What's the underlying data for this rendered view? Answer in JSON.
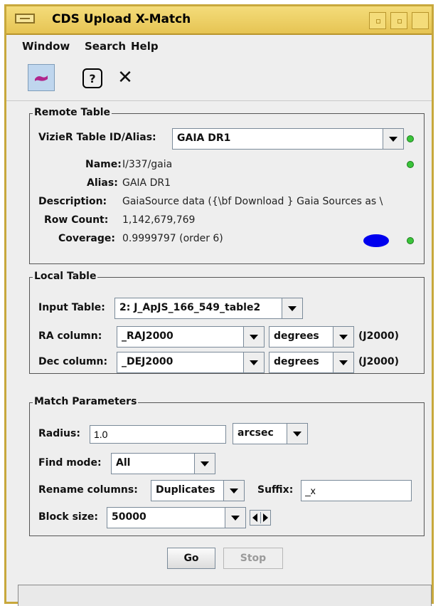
{
  "window": {
    "title": "CDS Upload X-Match"
  },
  "menubar": {
    "items": [
      "Window",
      "Search",
      "Help"
    ]
  },
  "toolbar": {
    "icons": [
      "query-active-icon",
      "help-icon",
      "close-icon"
    ],
    "help_glyph": "?",
    "close_glyph": "✕"
  },
  "remote": {
    "legend": "Remote Table",
    "vizier_label": "VizieR Table ID/Alias:",
    "vizier_value": "GAIA DR1",
    "name_label": "Name:",
    "name_value": "I/337/gaia",
    "alias_label": "Alias:",
    "alias_value": "GAIA DR1",
    "description_label": "Description:",
    "description_value": "GaiaSource data ({\\bf Download } Gaia Sources as \\",
    "rowcount_label": "Row Count:",
    "rowcount_value": "1,142,679,769",
    "coverage_label": "Coverage:",
    "coverage_value": "0.9999797 (order 6)",
    "status_color": "#3ac43a",
    "coverage_color": "#0000ee"
  },
  "local": {
    "legend": "Local Table",
    "input_label": "Input Table:",
    "input_value": "2: J_ApJS_166_549_table2",
    "ra_label": "RA column:",
    "ra_value": "_RAJ2000",
    "ra_unit": "degrees",
    "ra_epoch": "(J2000)",
    "dec_label": "Dec column:",
    "dec_value": "_DEJ2000",
    "dec_unit": "degrees",
    "dec_epoch": "(J2000)"
  },
  "match": {
    "legend": "Match Parameters",
    "radius_label": "Radius:",
    "radius_value": "1.0",
    "radius_unit": "arcsec",
    "find_label": "Find mode:",
    "find_value": "All",
    "rename_label": "Rename columns:",
    "rename_value": "Duplicates",
    "suffix_label": "Suffix:",
    "suffix_value": "_x",
    "block_label": "Block size:",
    "block_value": "50000"
  },
  "actions": {
    "go": "Go",
    "stop": "Stop"
  }
}
